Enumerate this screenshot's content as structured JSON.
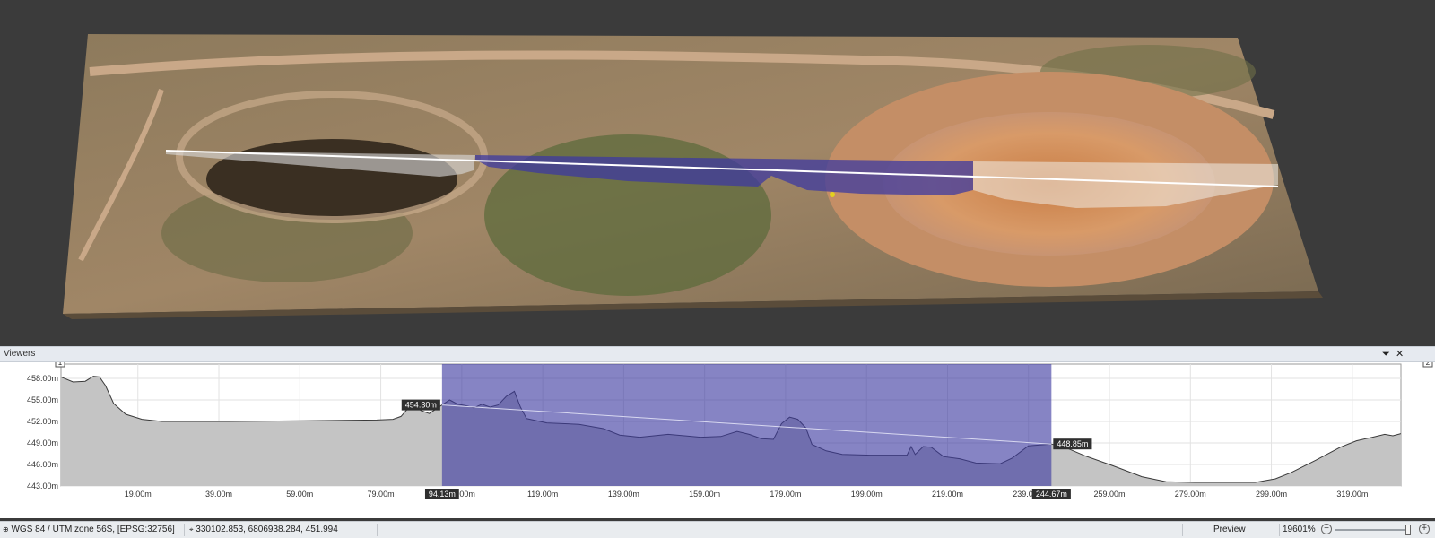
{
  "viewers_panel": {
    "title": "Viewers",
    "pin_icon": "pin-icon",
    "close_icon": "close-icon",
    "marker_start": "1",
    "marker_end": "2"
  },
  "colors": {
    "background_3d": "#3b3b3b",
    "terrain": "#9a8466",
    "selection": "#5c5aa8",
    "profile_fill": "#c4c4c4",
    "label_bg": "#2f2f2f"
  },
  "chart_data": {
    "type": "area",
    "x_ticks": [
      "19.00m",
      "39.00m",
      "59.00m",
      "79.00m",
      "99.00m",
      "119.00m",
      "139.00m",
      "159.00m",
      "179.00m",
      "199.00m",
      "219.00m",
      "239.00m",
      "259.00m",
      "279.00m",
      "299.00m",
      "319.00m"
    ],
    "y_ticks": [
      "458.00m",
      "455.00m",
      "452.00m",
      "449.00m",
      "446.00m",
      "443.00m"
    ],
    "xlim": [
      0,
      331
    ],
    "ylim": [
      443,
      460
    ],
    "grid": true,
    "profile": [
      [
        0,
        458.2
      ],
      [
        3,
        457.5
      ],
      [
        6,
        457.6
      ],
      [
        8,
        458.3
      ],
      [
        9.5,
        458.2
      ],
      [
        11,
        457.0
      ],
      [
        13,
        454.5
      ],
      [
        16,
        453.0
      ],
      [
        20,
        452.3
      ],
      [
        25,
        452.0
      ],
      [
        40,
        452.0
      ],
      [
        60,
        452.1
      ],
      [
        78,
        452.2
      ],
      [
        82,
        452.3
      ],
      [
        84,
        452.7
      ],
      [
        86,
        454.0
      ],
      [
        87.5,
        454.1
      ],
      [
        89,
        453.5
      ],
      [
        91,
        453.1
      ],
      [
        94.13,
        454.3
      ],
      [
        96,
        455.0
      ],
      [
        98,
        454.4
      ],
      [
        100,
        454.2
      ],
      [
        102,
        453.9
      ],
      [
        104,
        454.4
      ],
      [
        106,
        454.0
      ],
      [
        108,
        454.3
      ],
      [
        110,
        455.5
      ],
      [
        112,
        456.2
      ],
      [
        113.5,
        454.0
      ],
      [
        115,
        452.4
      ],
      [
        120,
        451.8
      ],
      [
        128,
        451.6
      ],
      [
        134,
        451.0
      ],
      [
        138,
        450.1
      ],
      [
        143,
        449.8
      ],
      [
        150,
        450.2
      ],
      [
        158,
        449.8
      ],
      [
        163,
        449.9
      ],
      [
        167,
        450.6
      ],
      [
        170,
        450.2
      ],
      [
        173,
        449.6
      ],
      [
        176,
        449.5
      ],
      [
        178,
        451.7
      ],
      [
        180,
        452.6
      ],
      [
        182,
        452.3
      ],
      [
        184,
        451.1
      ],
      [
        185.5,
        448.8
      ],
      [
        189,
        447.9
      ],
      [
        193,
        447.4
      ],
      [
        200,
        447.3
      ],
      [
        209,
        447.3
      ],
      [
        210,
        448.5
      ],
      [
        211,
        447.4
      ],
      [
        213,
        448.5
      ],
      [
        215,
        448.4
      ],
      [
        218,
        447.1
      ],
      [
        222,
        446.8
      ],
      [
        226,
        446.2
      ],
      [
        232,
        446.1
      ],
      [
        235,
        446.9
      ],
      [
        239,
        448.6
      ],
      [
        244.67,
        448.85
      ],
      [
        248,
        448.4
      ],
      [
        253,
        447.2
      ],
      [
        260,
        445.8
      ],
      [
        267,
        444.3
      ],
      [
        273,
        443.6
      ],
      [
        280,
        443.5
      ],
      [
        295,
        443.5
      ],
      [
        300,
        444.0
      ],
      [
        304,
        444.9
      ],
      [
        310,
        446.6
      ],
      [
        316,
        448.4
      ],
      [
        320,
        449.3
      ],
      [
        324,
        449.8
      ],
      [
        327,
        450.2
      ],
      [
        329,
        450.0
      ],
      [
        331,
        450.3
      ]
    ],
    "selection": {
      "start": 94.13,
      "end": 244.67
    },
    "start_label": "94.13m",
    "end_label": "244.67m",
    "left_elevation_label": "454.30m",
    "right_elevation_label": "448.85m",
    "left_elevation": 454.3,
    "right_elevation": 448.85
  },
  "statusbar": {
    "crs": "WGS 84 / UTM zone 56S, [EPSG:32756]",
    "coordinates": "330102.853, 6806938.284, 451.994",
    "mode": "Preview",
    "zoom": "19601%",
    "zoom_out": "−",
    "zoom_in": "+"
  }
}
